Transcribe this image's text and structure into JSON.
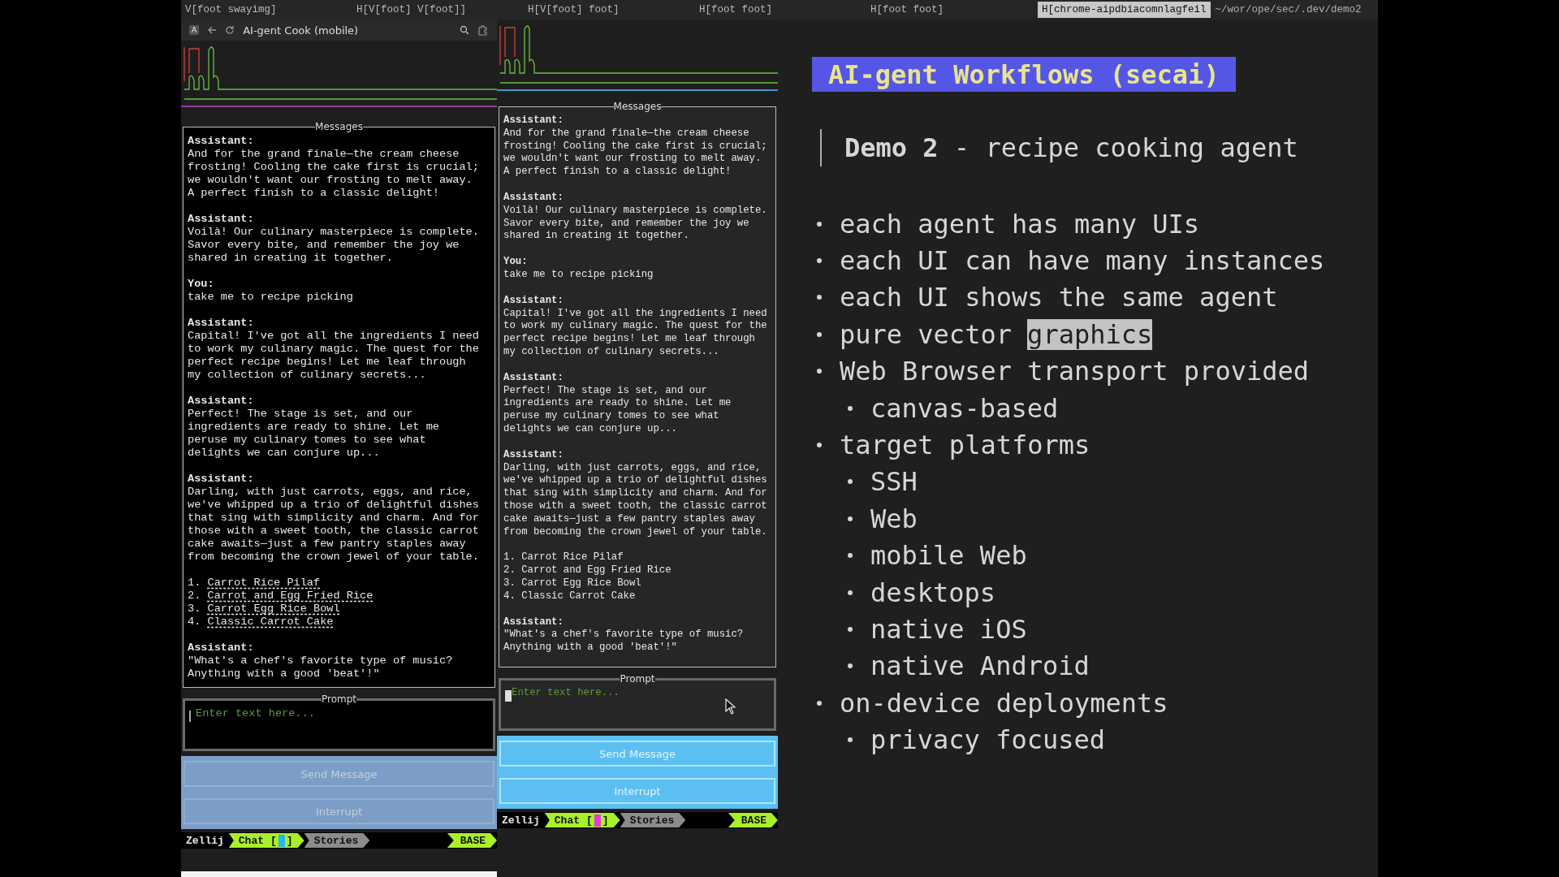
{
  "tab_bar": {
    "tabs": [
      {
        "label": "V[foot swayimg]",
        "selected": false
      },
      {
        "label": "H[V[foot] V[foot]]",
        "selected": false
      },
      {
        "label": "H[V[foot] foot]",
        "selected": false
      },
      {
        "label": "H[foot foot]",
        "selected": false
      },
      {
        "label": "H[foot foot]",
        "selected": false
      },
      {
        "label": "H[chrome-aipdbiacomnlagfeil",
        "selected": true
      }
    ],
    "path": "~/wor/ope/sec/.dev/demo2"
  },
  "browser": {
    "badge": "A",
    "title": "AI-gent Cook (mobile)"
  },
  "panes": [
    {
      "kind": "browser",
      "active": false,
      "messages_title": "Messages",
      "messages": [
        {
          "role": "Assistant:",
          "text": "And for the grand finale—the cream cheese\nfrosting! Cooling the cake first is crucial;\nwe wouldn't want our frosting to melt away.\nA perfect finish to a classic delight!"
        },
        {
          "role": "Assistant:",
          "text": "Voilà! Our culinary masterpiece is complete.\nSavor every bite, and remember the joy we\nshared in creating it together."
        },
        {
          "role": "You:",
          "text": "take me to recipe picking"
        },
        {
          "role": "Assistant:",
          "text": "Capital! I've got all the ingredients I need\nto work my culinary magic. The quest for the\nperfect recipe begins! Let me leaf through\nmy collection of culinary secrets..."
        },
        {
          "role": "Assistant:",
          "text": "Perfect! The stage is set, and our\ningredients are ready to shine. Let me\nperuse my culinary tomes to see what\ndelights we can conjure up..."
        },
        {
          "role": "Assistant:",
          "text": "Darling, with just carrots, eggs, and rice,\nwe've whipped up a trio of delightful dishes\nthat sing with simplicity and charm. And for\nthose with a sweet tooth, the classic carrot\ncake awaits—just a few pantry staples away\nfrom becoming the crown jewel of your table.",
          "recipes": [
            {
              "number": "1.",
              "title": "Carrot Rice Pilaf",
              "link": true
            },
            {
              "number": "2.",
              "title": "Carrot and Egg Fried Rice",
              "link": true
            },
            {
              "number": "3.",
              "title": "Carrot Egg Rice Bowl",
              "link": true
            },
            {
              "number": "4.",
              "title": "Classic Carrot Cake",
              "link": true
            }
          ]
        },
        {
          "role": "Assistant:",
          "text": "\"What's a chef's favorite type of music?\nAnything with a good 'beat'!\""
        }
      ],
      "prompt_title": "Prompt",
      "placeholder": "Enter text here...",
      "buttons": [
        "Send Message",
        "Interrupt"
      ],
      "status": {
        "session": "Zellij",
        "tabs": [
          {
            "label": "Chat",
            "open": "[",
            "close": "]",
            "selected": true,
            "color": "#29b6e8"
          },
          {
            "label": "Stories",
            "selected": false
          }
        ],
        "mode": "BASE"
      }
    },
    {
      "kind": "terminal",
      "active": true,
      "messages_title": "Messages",
      "messages": [
        {
          "role": "Assistant:",
          "text": "And for the grand finale—the cream cheese\nfrosting! Cooling the cake first is crucial;\nwe wouldn't want our frosting to melt away.\nA perfect finish to a classic delight!"
        },
        {
          "role": "Assistant:",
          "text": "Voilà! Our culinary masterpiece is complete.\nSavor every bite, and remember the joy we\nshared in creating it together."
        },
        {
          "role": "You:",
          "text": "take me to recipe picking"
        },
        {
          "role": "Assistant:",
          "text": "Capital! I've got all the ingredients I need\nto work my culinary magic. The quest for the\nperfect recipe begins! Let me leaf through\nmy collection of culinary secrets..."
        },
        {
          "role": "Assistant:",
          "text": "Perfect! The stage is set, and our\ningredients are ready to shine. Let me\nperuse my culinary tomes to see what\ndelights we can conjure up..."
        },
        {
          "role": "Assistant:",
          "text": "Darling, with just carrots, eggs, and rice,\nwe've whipped up a trio of delightful dishes\nthat sing with simplicity and charm. And for\nthose with a sweet tooth, the classic carrot\ncake awaits—just a few pantry staples away\nfrom becoming the crown jewel of your table.",
          "recipes": [
            {
              "number": "1.",
              "title": "Carrot Rice Pilaf",
              "link": false
            },
            {
              "number": "2.",
              "title": "Carrot and Egg Fried Rice",
              "link": false
            },
            {
              "number": "3.",
              "title": "Carrot Egg Rice Bowl",
              "link": false
            },
            {
              "number": "4.",
              "title": "Classic Carrot Cake",
              "link": false
            }
          ]
        },
        {
          "role": "Assistant:",
          "text": "\"What's a chef's favorite type of music?\nAnything with a good 'beat'!\""
        }
      ],
      "prompt_title": "Prompt",
      "placeholder": "Enter text here...",
      "buttons": [
        "Send Message",
        "Interrupt"
      ],
      "status": {
        "session": "Zellij",
        "tabs": [
          {
            "label": "Chat",
            "open": "[",
            "close": "]",
            "selected": true,
            "color": "#e83ad8"
          },
          {
            "label": "Stories",
            "selected": false
          }
        ],
        "mode": "BASE"
      }
    }
  ],
  "slide": {
    "title": "AI-gent Workflows (secai)",
    "heading": "**Demo 2** - recipe cooking agent",
    "bullets": [
      {
        "segments": [
          {
            "text": "each agent has many UIs",
            "highlighted": false
          }
        ]
      },
      {
        "segments": [
          {
            "text": "each UI can have many instances",
            "highlighted": false
          }
        ]
      },
      {
        "segments": [
          {
            "text": "each UI shows the same agent",
            "highlighted": false
          }
        ]
      },
      {
        "segments": [
          {
            "text": "pure vector",
            "highlighted": false
          },
          {
            "text": "graphics",
            "highlighted": true
          }
        ]
      },
      {
        "segments": [
          {
            "text": "Web Browser transport provided",
            "highlighted": false
          }
        ],
        "children": [
          {
            "segments": [
              {
                "text": "canvas-based",
                "highlighted": false
              }
            ]
          }
        ]
      },
      {
        "segments": [
          {
            "text": "target platforms",
            "highlighted": false
          }
        ],
        "children": [
          {
            "segments": [
              {
                "text": "SSH",
                "highlighted": false
              }
            ]
          },
          {
            "segments": [
              {
                "text": "Web",
                "highlighted": false
              }
            ]
          },
          {
            "segments": [
              {
                "text": "mobile Web",
                "highlighted": false
              }
            ]
          },
          {
            "segments": [
              {
                "text": "desktops",
                "highlighted": false
              }
            ]
          },
          {
            "segments": [
              {
                "text": "native iOS",
                "highlighted": false
              }
            ]
          },
          {
            "segments": [
              {
                "text": "native Android",
                "highlighted": false
              }
            ]
          }
        ]
      },
      {
        "segments": [
          {
            "text": "on-device deployments",
            "highlighted": false
          }
        ],
        "children": [
          {
            "segments": [
              {
                "text": "privacy focused",
                "highlighted": false
              }
            ]
          }
        ]
      }
    ]
  }
}
